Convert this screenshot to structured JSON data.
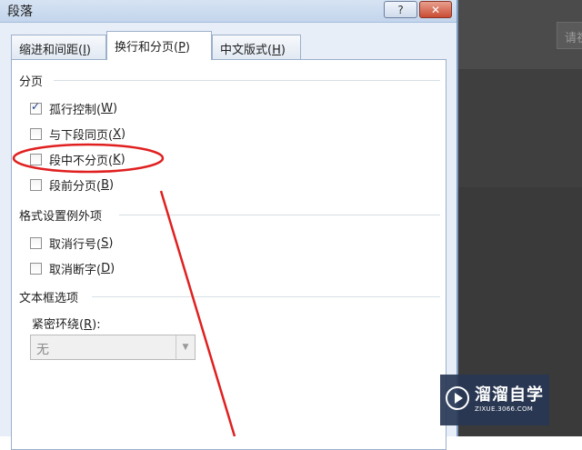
{
  "dialog": {
    "title": "段落",
    "help_label": "?",
    "close_label": "✕",
    "tabs": [
      {
        "text": "缩进和间距(",
        "key": "I",
        "end": ")"
      },
      {
        "text": "换行和分页(",
        "key": "P",
        "end": ")"
      },
      {
        "text": "中文版式(",
        "key": "H",
        "end": ")"
      }
    ],
    "active_tab": 1,
    "sections": {
      "pagination": "分页",
      "format_exceptions": "格式设置例外项",
      "textbox_options": "文本框选项"
    },
    "checkboxes": [
      {
        "text": "孤行控制(",
        "key": "W",
        "end": ")",
        "checked": true
      },
      {
        "text": "与下段同页(",
        "key": "X",
        "end": ")",
        "checked": false
      },
      {
        "text": "段中不分页(",
        "key": "K",
        "end": ")",
        "checked": false
      },
      {
        "text": "段前分页(",
        "key": "B",
        "end": ")",
        "checked": false
      },
      {
        "text": "取消行号(",
        "key": "S",
        "end": ")",
        "checked": false
      },
      {
        "text": "取消断字(",
        "key": "D",
        "end": ")",
        "checked": false
      }
    ],
    "tight_wrap": {
      "text": "紧密环绕(",
      "key": "R",
      "end": "):",
      "value": "无"
    }
  },
  "background_app": {
    "button_label": "请祝"
  },
  "watermark": {
    "title": "溜溜自学",
    "subtitle": "ZIXUE.3066.COM"
  },
  "annotation_color": "#e02020"
}
